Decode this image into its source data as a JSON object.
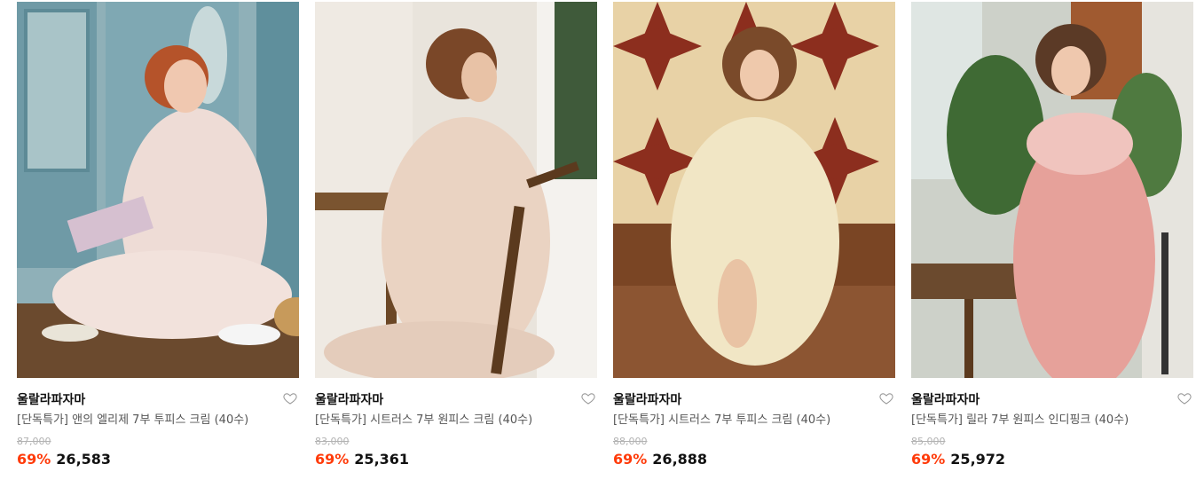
{
  "products": [
    {
      "brand": "울랄라파자마",
      "title": "[단독특가] 앤의 엘리제 7부 투피스 크림 (40수)",
      "original_price": "87,000",
      "discount": "69%",
      "price": "26,583",
      "image_alt": "woman in floral pajamas reading at a table"
    },
    {
      "brand": "울랄라파자마",
      "title": "[단독특가] 시트러스 7부 원피스 크림 (40수)",
      "original_price": "83,000",
      "discount": "69%",
      "price": "25,361",
      "image_alt": "woman in cream floral dress seated on wooden chair"
    },
    {
      "brand": "울랄라파자마",
      "title": "[단독특가] 시트러스 7부 투피스 크림 (40수)",
      "original_price": "88,000",
      "discount": "69%",
      "price": "26,888",
      "image_alt": "woman in floral two-piece sitting before patterned tile wall"
    },
    {
      "brand": "울랄라파자마",
      "title": "[단독특가] 릴라 7부 원피스 인디핑크 (40수)",
      "original_price": "85,000",
      "discount": "69%",
      "price": "25,972",
      "image_alt": "woman in pink ruffled nightdress leaning on table"
    }
  ],
  "colors": {
    "discount": "#ff3b0a",
    "brand_text": "#111111",
    "title_text": "#555555",
    "strike_text": "#b3b3b3"
  },
  "icons": {
    "wishlist": "heart-outline-icon"
  }
}
